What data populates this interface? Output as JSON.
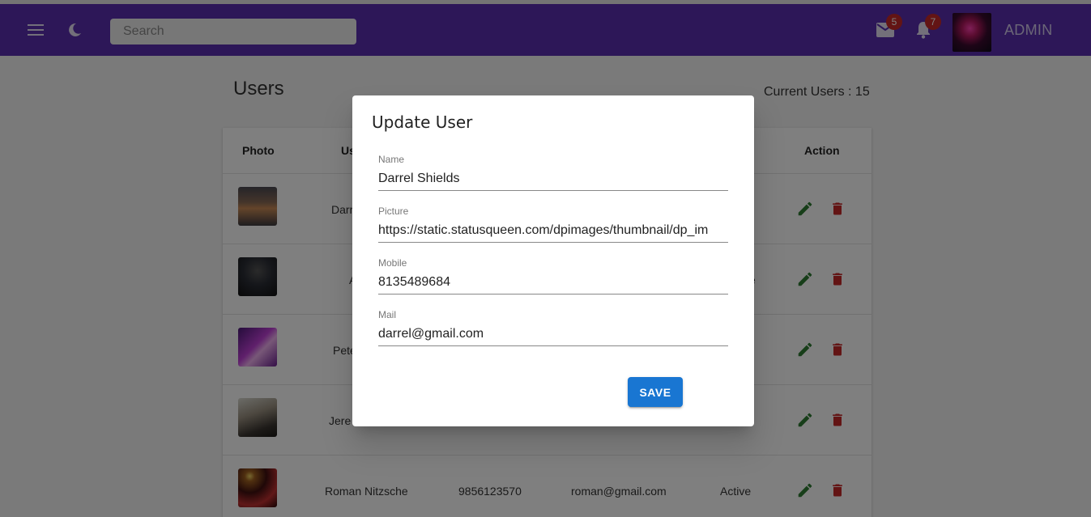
{
  "header": {
    "search_placeholder": "Search",
    "mail_count": "5",
    "notification_count": "7",
    "user_label": "ADMIN"
  },
  "page": {
    "title": "Users",
    "current_users": "Current Users : 15"
  },
  "table": {
    "headers": {
      "photo": "Photo",
      "user_partial": "Us",
      "action": "Action"
    },
    "rows": [
      {
        "name": "Darr",
        "mobile": "",
        "mail": "",
        "status": ""
      },
      {
        "name": "A",
        "mobile": "",
        "mail": "",
        "status": "e"
      },
      {
        "name": "Pete",
        "mobile": "",
        "mail": "",
        "status": ""
      },
      {
        "name": "Jere",
        "mobile": "",
        "mail": "",
        "status": ""
      },
      {
        "name": "Roman Nitzsche",
        "mobile": "9856123570",
        "mail": "roman@gmail.com",
        "status": "Active"
      }
    ]
  },
  "dialog": {
    "title": "Update User",
    "name_label": "Name",
    "name_value": "Darrel Shields",
    "picture_label": "Picture",
    "picture_value": "https://static.statusqueen.com/dpimages/thumbnail/dp_im",
    "mobile_label": "Mobile",
    "mobile_value": "8135489684",
    "mail_label": "Mail",
    "mail_value": "darrel@gmail.com",
    "save_label": "SAVE"
  },
  "colors": {
    "header_bg": "#5a2fb0",
    "badge": "#c62828",
    "edit_icon": "#2e7d32",
    "delete_icon": "#c62828",
    "save_button": "#1976d2"
  },
  "icons": {
    "menu": "menu-icon",
    "theme": "moon-icon",
    "mail": "mail-icon",
    "notifications": "bell-icon",
    "edit": "pencil-icon",
    "delete": "trash-icon"
  }
}
